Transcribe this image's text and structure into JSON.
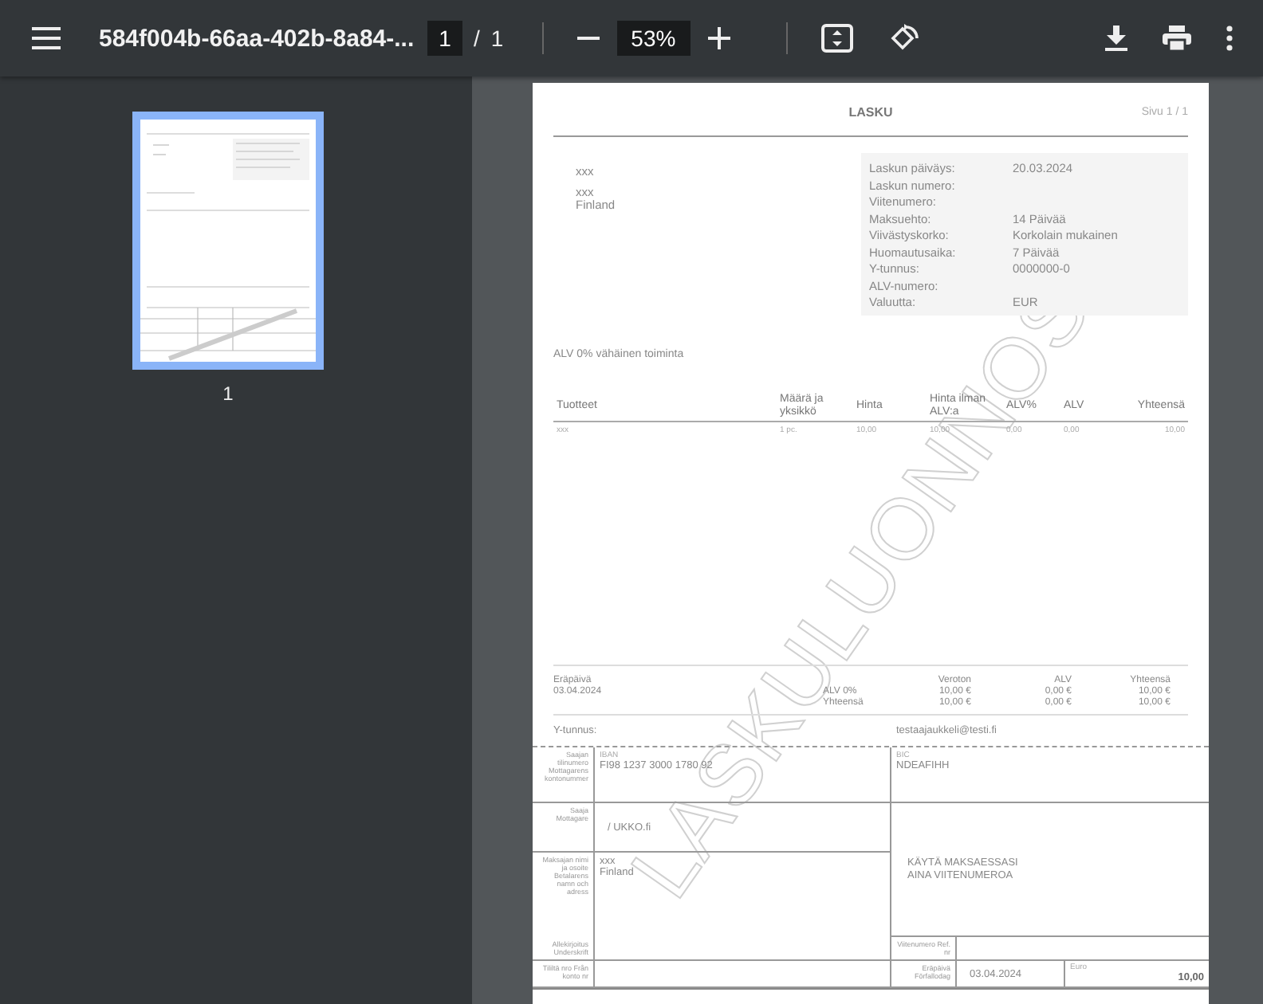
{
  "toolbar": {
    "title": "584f004b-66aa-402b-8a84-...",
    "page_input": "1",
    "page_separator": "/",
    "page_count": "1",
    "zoom": "53%"
  },
  "thumbnails": [
    {
      "label": "1",
      "selected": true
    }
  ],
  "document": {
    "title": "LASKU",
    "page_label": "Sivu 1 / 1",
    "recipient_lines": [
      "xxx",
      "xxx",
      "Finland"
    ],
    "info": [
      {
        "label": "Laskun päiväys:",
        "value": "20.03.2024"
      },
      {
        "label": "Laskun numero:"
      },
      {
        "label": "Viitenumero:"
      },
      {
        "label": "Maksuehto:",
        "value": "14 Päivää"
      },
      {
        "label": "Viivästyskorko:",
        "value": "Korkolain mukainen"
      },
      {
        "label": "Huomautusaika:",
        "value": "7 Päivää"
      },
      {
        "label": "Y-tunnus:",
        "value": "0000000-0"
      },
      {
        "label": "ALV-numero:"
      },
      {
        "label": "Valuutta:",
        "value": "EUR"
      }
    ],
    "vat_note": "ALV 0% vähäinen toiminta",
    "table": {
      "columns": [
        "Tuotteet",
        "Määrä ja yksikkö",
        "Hinta",
        "Hinta ilman ALV:a",
        "ALV%",
        "ALV",
        "Yhteensä"
      ],
      "rows": [
        [
          "xxx",
          "1 pc.",
          "10,00",
          "10,00",
          "0,00",
          "0,00",
          "10,00"
        ]
      ]
    },
    "due_label": "Eräpäivä",
    "due_date": "03.04.2024",
    "totals": {
      "headers": [
        "Veroton",
        "ALV",
        "Yhteensä"
      ],
      "rows": [
        {
          "label": "ALV 0%",
          "cells": [
            "10,00 €",
            "0,00 €",
            "10,00 €"
          ]
        },
        {
          "label": "Yhteensä",
          "cells": [
            "10,00 €",
            "0,00 €",
            "10,00 €"
          ]
        }
      ]
    },
    "business_id_label": "Y-tunnus:",
    "email": "testaajaukkeli@testi.fi",
    "giro": {
      "account_label": "Saajan tilinumero Mottagarens kontonummer",
      "iban_label": "IBAN",
      "iban": "FI98 1237 3000 1780 92",
      "bic_label": "BIC",
      "bic": "NDEAFIHH",
      "payee_label": "Saaja Mottagare",
      "payee": "/ UKKO.fi",
      "notice_lines": [
        "KÄYTÄ MAKSAESSASI",
        "AINA VIITENUMEROA"
      ],
      "payer_label": "Maksajan nimi ja osoite Betalarens namn och adress",
      "payer_lines": [
        "xxx",
        "Finland"
      ],
      "signature_label": "Allekirjoitus Underskrift",
      "reference_label": "Viitenumero Ref. nr",
      "from_account_label": "Tililtä nro Från konto nr",
      "due_label": "Eräpäivä Förfallodag",
      "due_date": "03.04.2024",
      "euro_label": "Euro",
      "amount": "10,00"
    },
    "watermark": "LASKULUONNOS"
  }
}
